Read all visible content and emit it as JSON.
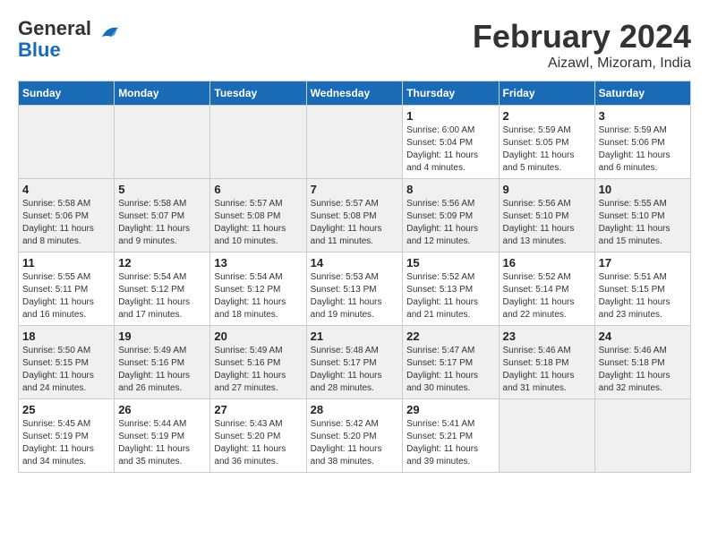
{
  "header": {
    "logo_line1": "General",
    "logo_line2": "Blue",
    "month_title": "February 2024",
    "location": "Aizawl, Mizoram, India"
  },
  "weekdays": [
    "Sunday",
    "Monday",
    "Tuesday",
    "Wednesday",
    "Thursday",
    "Friday",
    "Saturday"
  ],
  "weeks": [
    [
      {
        "day": "",
        "empty": true
      },
      {
        "day": "",
        "empty": true
      },
      {
        "day": "",
        "empty": true
      },
      {
        "day": "",
        "empty": true
      },
      {
        "day": "1",
        "sunrise": "6:00 AM",
        "sunset": "5:04 PM",
        "daylight": "11 hours and 4 minutes."
      },
      {
        "day": "2",
        "sunrise": "5:59 AM",
        "sunset": "5:05 PM",
        "daylight": "11 hours and 5 minutes."
      },
      {
        "day": "3",
        "sunrise": "5:59 AM",
        "sunset": "5:06 PM",
        "daylight": "11 hours and 6 minutes."
      }
    ],
    [
      {
        "day": "4",
        "sunrise": "5:58 AM",
        "sunset": "5:06 PM",
        "daylight": "11 hours and 8 minutes."
      },
      {
        "day": "5",
        "sunrise": "5:58 AM",
        "sunset": "5:07 PM",
        "daylight": "11 hours and 9 minutes."
      },
      {
        "day": "6",
        "sunrise": "5:57 AM",
        "sunset": "5:08 PM",
        "daylight": "11 hours and 10 minutes."
      },
      {
        "day": "7",
        "sunrise": "5:57 AM",
        "sunset": "5:08 PM",
        "daylight": "11 hours and 11 minutes."
      },
      {
        "day": "8",
        "sunrise": "5:56 AM",
        "sunset": "5:09 PM",
        "daylight": "11 hours and 12 minutes."
      },
      {
        "day": "9",
        "sunrise": "5:56 AM",
        "sunset": "5:10 PM",
        "daylight": "11 hours and 13 minutes."
      },
      {
        "day": "10",
        "sunrise": "5:55 AM",
        "sunset": "5:10 PM",
        "daylight": "11 hours and 15 minutes."
      }
    ],
    [
      {
        "day": "11",
        "sunrise": "5:55 AM",
        "sunset": "5:11 PM",
        "daylight": "11 hours and 16 minutes."
      },
      {
        "day": "12",
        "sunrise": "5:54 AM",
        "sunset": "5:12 PM",
        "daylight": "11 hours and 17 minutes."
      },
      {
        "day": "13",
        "sunrise": "5:54 AM",
        "sunset": "5:12 PM",
        "daylight": "11 hours and 18 minutes."
      },
      {
        "day": "14",
        "sunrise": "5:53 AM",
        "sunset": "5:13 PM",
        "daylight": "11 hours and 19 minutes."
      },
      {
        "day": "15",
        "sunrise": "5:52 AM",
        "sunset": "5:13 PM",
        "daylight": "11 hours and 21 minutes."
      },
      {
        "day": "16",
        "sunrise": "5:52 AM",
        "sunset": "5:14 PM",
        "daylight": "11 hours and 22 minutes."
      },
      {
        "day": "17",
        "sunrise": "5:51 AM",
        "sunset": "5:15 PM",
        "daylight": "11 hours and 23 minutes."
      }
    ],
    [
      {
        "day": "18",
        "sunrise": "5:50 AM",
        "sunset": "5:15 PM",
        "daylight": "11 hours and 24 minutes."
      },
      {
        "day": "19",
        "sunrise": "5:49 AM",
        "sunset": "5:16 PM",
        "daylight": "11 hours and 26 minutes."
      },
      {
        "day": "20",
        "sunrise": "5:49 AM",
        "sunset": "5:16 PM",
        "daylight": "11 hours and 27 minutes."
      },
      {
        "day": "21",
        "sunrise": "5:48 AM",
        "sunset": "5:17 PM",
        "daylight": "11 hours and 28 minutes."
      },
      {
        "day": "22",
        "sunrise": "5:47 AM",
        "sunset": "5:17 PM",
        "daylight": "11 hours and 30 minutes."
      },
      {
        "day": "23",
        "sunrise": "5:46 AM",
        "sunset": "5:18 PM",
        "daylight": "11 hours and 31 minutes."
      },
      {
        "day": "24",
        "sunrise": "5:46 AM",
        "sunset": "5:18 PM",
        "daylight": "11 hours and 32 minutes."
      }
    ],
    [
      {
        "day": "25",
        "sunrise": "5:45 AM",
        "sunset": "5:19 PM",
        "daylight": "11 hours and 34 minutes."
      },
      {
        "day": "26",
        "sunrise": "5:44 AM",
        "sunset": "5:19 PM",
        "daylight": "11 hours and 35 minutes."
      },
      {
        "day": "27",
        "sunrise": "5:43 AM",
        "sunset": "5:20 PM",
        "daylight": "11 hours and 36 minutes."
      },
      {
        "day": "28",
        "sunrise": "5:42 AM",
        "sunset": "5:20 PM",
        "daylight": "11 hours and 38 minutes."
      },
      {
        "day": "29",
        "sunrise": "5:41 AM",
        "sunset": "5:21 PM",
        "daylight": "11 hours and 39 minutes."
      },
      {
        "day": "",
        "empty": true
      },
      {
        "day": "",
        "empty": true
      }
    ]
  ]
}
